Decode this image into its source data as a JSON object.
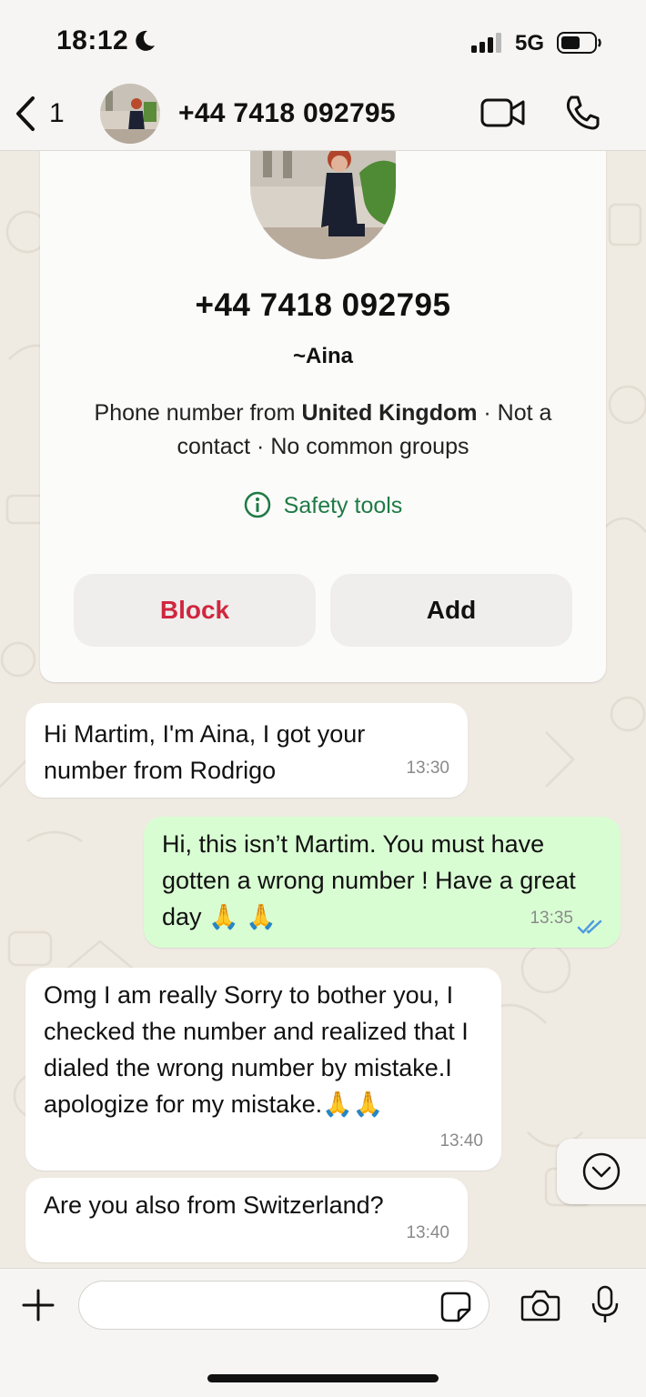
{
  "status_bar": {
    "time": "18:12",
    "network": "5G",
    "icons": [
      "moon-icon",
      "signal-icon",
      "battery-icon"
    ]
  },
  "header": {
    "back_count": "1",
    "title": "+44 7418 092795",
    "icons": [
      "back-chevron-icon",
      "video-call-icon",
      "phone-call-icon"
    ]
  },
  "contact_card": {
    "phone": "+44 7418 092795",
    "name": "~Aina",
    "info_prefix": "Phone number from ",
    "info_country": "United Kingdom",
    "info_suffix": " · Not a contact · No common groups",
    "safety_label": "Safety tools",
    "block_label": "Block",
    "add_label": "Add"
  },
  "messages": [
    {
      "direction": "incoming",
      "text": "Hi Martim, I'm Aina, I got your number from Rodrigo",
      "time": "13:30"
    },
    {
      "direction": "outgoing",
      "text": "Hi, this isn’t Martim. You must have gotten a wrong number ! Have a great day 🙏 🙏",
      "time": "13:35",
      "status": "read"
    },
    {
      "direction": "incoming",
      "text": "Omg I am really Sorry to bother you, I checked the number and realized that I dialed the wrong number by mistake.I apologize for my mistake.🙏🙏",
      "time": "13:40"
    },
    {
      "direction": "incoming",
      "text": "Are you also from Switzerland?",
      "time": "13:40"
    }
  ],
  "composer": {
    "placeholder": "",
    "icons": [
      "plus-icon",
      "sticker-icon",
      "camera-icon",
      "microphone-icon"
    ]
  },
  "colors": {
    "outgoing_bubble": "#d9fdd3",
    "incoming_bubble": "#ffffff",
    "block_red": "#d0263f",
    "safety_green": "#1f7a45",
    "read_ticks": "#4f9be0"
  }
}
